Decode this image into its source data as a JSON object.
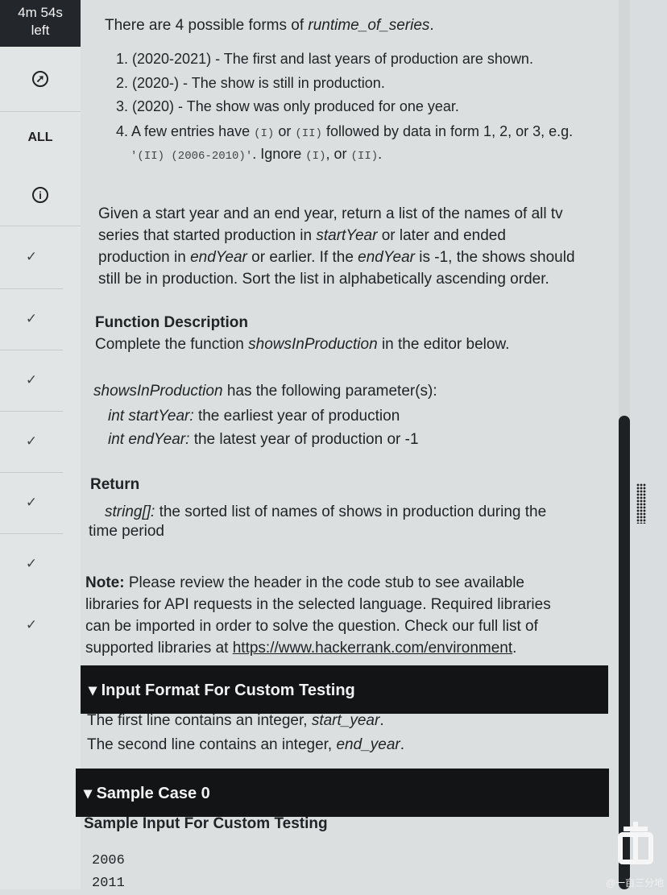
{
  "sidebar": {
    "timer_line1": "4m 54s",
    "timer_line2": "left",
    "all_label": "ALL",
    "icons": [
      "compass-icon",
      "info-icon",
      "check-icon"
    ],
    "check_glyph": "✓",
    "info_glyph": "i"
  },
  "problem": {
    "forms_intro_pre": "There are 4 possible forms of ",
    "forms_intro_em": "runtime_of_series",
    "forms_intro_post": ".",
    "forms": [
      "1. (2020-2021) - The first and last years of production are shown.",
      "2. (2020-) - The show is still in production.",
      "3. (2020) - The show was only produced for one year."
    ],
    "form4_a": "4. A few entries have ",
    "form4_code1": "(I)",
    "form4_b": " or ",
    "form4_code2": "(II)",
    "form4_c": " followed by data in form 1, 2, or 3, e.g.",
    "form4_code3": "'(II)  (2006-2010)'",
    "form4_d": ". Ignore ",
    "form4_code4": "(I)",
    "form4_e": ", or ",
    "form4_code5": "(II)",
    "form4_f": ".",
    "desc_line1": "Given a start year and an end year, return a list of the names of all tv",
    "desc_line2_pre": "series that started production in ",
    "desc_line2_em": "startYear",
    "desc_line2_post": " or later and ended",
    "desc_line3_pre": "production in ",
    "desc_line3_em1": "endYear",
    "desc_line3_mid": " or earlier. If the ",
    "desc_line3_em2": "endYear",
    "desc_line3_post": " is -1, the shows should",
    "desc_line4": "still be in production. Sort the list in alphabetically ascending order.",
    "func_heading": "Function Description",
    "func_text_pre": "Complete the function ",
    "func_text_em": "showsInProduction",
    "func_text_post": " in the editor below.",
    "params_em": "showsInProduction",
    "params_post": " has the following parameter(s):",
    "param1_em": "int startYear:",
    "param1_text": " the earliest year of production",
    "param2_em": "int endYear:",
    "param2_text": " the latest year of production or -1",
    "return_heading": "Return",
    "return_em": "string[]:",
    "return_text1": " the sorted list of names of shows in production during the",
    "return_text2": "time period",
    "note_bold": "Note:",
    "note_l1": " Please review the header in the code stub to see available",
    "note_l2": "libraries for API requests in the selected language. Required libraries",
    "note_l3": "can be imported in order to solve the question. Check our full list of",
    "note_l4_pre": "supported libraries at ",
    "note_link": "https://www.hackerrank.com/environment",
    "note_l4_post": "."
  },
  "input_format": {
    "header": "▾ Input Format For Custom Testing",
    "line1_pre": "The first line contains an integer, ",
    "line1_em": "start_year",
    "line1_post": ".",
    "line2_pre": "The second line contains an integer, ",
    "line2_em": "end_year",
    "line2_post": "."
  },
  "sample": {
    "header": "▾ Sample Case 0",
    "sub_heading": "Sample Input For Custom Testing",
    "input_lines": [
      "2006",
      "2011"
    ]
  },
  "watermark": "@一亩三分地"
}
